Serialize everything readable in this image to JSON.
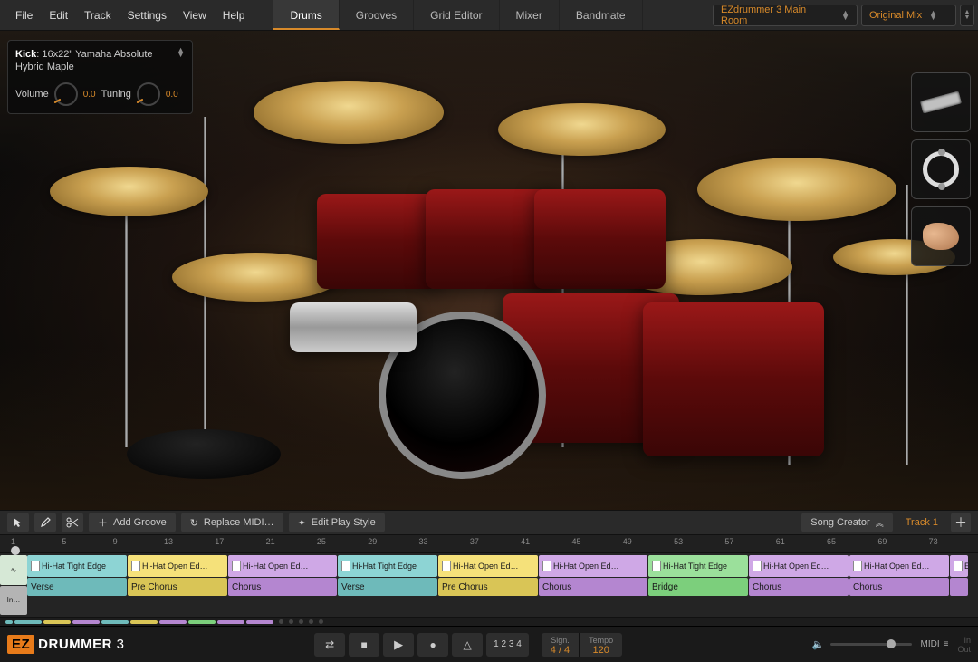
{
  "menu": [
    "File",
    "Edit",
    "Track",
    "Settings",
    "View",
    "Help"
  ],
  "tabs": [
    "Drums",
    "Grooves",
    "Grid Editor",
    "Mixer",
    "Bandmate"
  ],
  "active_tab": 0,
  "library": "EZdrummer 3 Main Room",
  "preset": "Original Mix",
  "piece": {
    "prefix": "Kick",
    "name": "16x22\" Yamaha Absolute Hybrid Maple",
    "volume_label": "Volume",
    "volume": "0.0",
    "tuning_label": "Tuning",
    "tuning": "0.0"
  },
  "extras": [
    "Shaker",
    "Tambourine",
    "Clap"
  ],
  "tools": {
    "add_groove": "Add Groove",
    "replace_midi": "Replace MIDI…",
    "edit_play_style": "Edit Play Style",
    "song_creator": "Song Creator",
    "track_label": "Track 1"
  },
  "ruler_start": 1,
  "ruler_step": 4,
  "ruler_count": 19,
  "intro_label": "In…",
  "segments": [
    {
      "width": 110,
      "clip": "Hi-Hat Tight Edge",
      "clip_cls": "c-teal",
      "section": "Verse",
      "sec_cls": "s-teal"
    },
    {
      "width": 110,
      "clip": "Hi-Hat Open Ed…",
      "clip_cls": "c-yellow",
      "section": "Pre Chorus",
      "sec_cls": "s-yellow"
    },
    {
      "width": 120,
      "clip": "Hi-Hat Open Ed…",
      "clip_cls": "c-purple",
      "section": "Chorus",
      "sec_cls": "s-purple"
    },
    {
      "width": 110,
      "clip": "Hi-Hat Tight Edge",
      "clip_cls": "c-teal",
      "section": "Verse",
      "sec_cls": "s-teal"
    },
    {
      "width": 110,
      "clip": "Hi-Hat Open Ed…",
      "clip_cls": "c-yellow",
      "section": "Pre Chorus",
      "sec_cls": "s-yellow"
    },
    {
      "width": 120,
      "clip": "Hi-Hat Open Ed…",
      "clip_cls": "c-purple",
      "section": "Chorus",
      "sec_cls": "s-purple"
    },
    {
      "width": 110,
      "clip": "Hi-Hat Tight Edge",
      "clip_cls": "c-green",
      "section": "Bridge",
      "sec_cls": "s-green"
    },
    {
      "width": 110,
      "clip": "Hi-Hat Open Ed…",
      "clip_cls": "c-purple",
      "section": "Chorus",
      "sec_cls": "s-purple"
    },
    {
      "width": 110,
      "clip": "Hi-Hat Open Ed…",
      "clip_cls": "c-purple",
      "section": "Chorus",
      "sec_cls": "s-purple"
    },
    {
      "width": 20,
      "clip": "E",
      "clip_cls": "c-purple",
      "section": "",
      "sec_cls": "s-purple"
    }
  ],
  "transport": {
    "logo_prefix": "EZ",
    "logo_main": "DRUMMER",
    "logo_suffix": "3",
    "count": "1 2 3 4",
    "sign_label": "Sign.",
    "sign": "4 / 4",
    "tempo_label": "Tempo",
    "tempo": "120",
    "midi_label": "MIDI",
    "in": "In",
    "out": "Out"
  }
}
